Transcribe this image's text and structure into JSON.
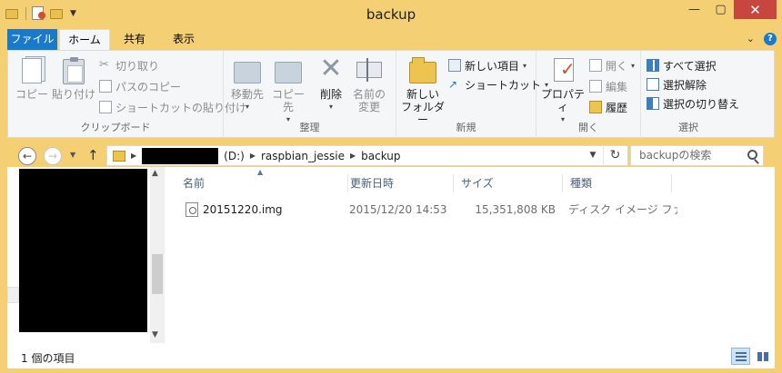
{
  "window": {
    "title": "backup"
  },
  "tabs": {
    "file": "ファイル",
    "home": "ホーム",
    "share": "共有",
    "view": "表示"
  },
  "ribbon": {
    "clipboard": {
      "label": "クリップボード",
      "copy": "コピー",
      "paste": "貼り付け",
      "cut": "切り取り",
      "copy_path": "パスのコピー",
      "paste_shortcut": "ショートカットの貼り付け"
    },
    "organize": {
      "label": "整理",
      "move_to": "移動先",
      "copy_to": "コピー先",
      "delete": "削除",
      "rename_line1": "名前の",
      "rename_line2": "変更"
    },
    "new": {
      "label": "新規",
      "new_folder_line1": "新しい",
      "new_folder_line2": "フォルダー",
      "new_item": "新しい項目",
      "shortcut": "ショートカット"
    },
    "open": {
      "label": "開く",
      "properties": "プロパティ",
      "open": "開く",
      "edit": "編集",
      "history": "履歴"
    },
    "select": {
      "label": "選択",
      "select_all": "すべて選択",
      "select_none": "選択解除",
      "invert": "選択の切り替え"
    }
  },
  "address": {
    "drive": "(D:)",
    "segments": [
      "raspbian_jessie",
      "backup"
    ],
    "search_placeholder": "backupの検索"
  },
  "columns": {
    "name": "名前",
    "date": "更新日時",
    "size": "サイズ",
    "type": "種類"
  },
  "files": [
    {
      "name": "20151220.img",
      "date": "2015/12/20 14:53",
      "size": "15,351,808 KB",
      "type": "ディスク イメージ ファ..."
    }
  ],
  "status": {
    "count": "1 個の項目"
  }
}
